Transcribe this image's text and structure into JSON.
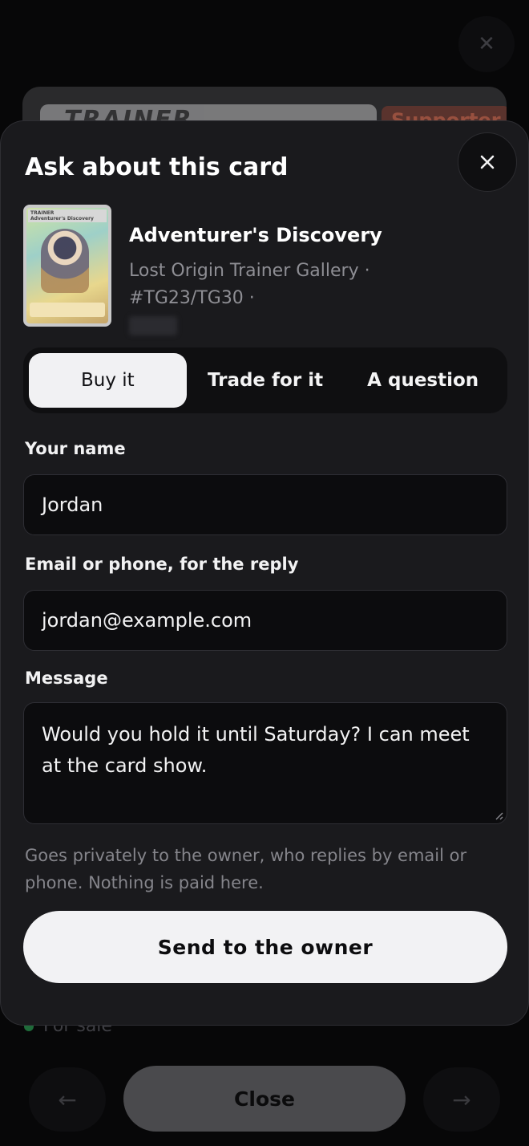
{
  "background": {
    "card_type": "TRAINER",
    "card_subtype": "Supporter",
    "status": "For sale",
    "close_label": "Close",
    "prev_arrow": "←",
    "next_arrow": "→",
    "icons": [
      "close-icon",
      "arrow-left-icon",
      "arrow-right-icon"
    ]
  },
  "sheet": {
    "title": "Ask about this card",
    "card": {
      "name": "Adventurer's Discovery",
      "meta": "Lost Origin Trainer Gallery · #TG23/TG30 ·",
      "thumb_type": "TRAINER",
      "thumb_name": "Adventurer's Discovery"
    },
    "tabs": [
      {
        "label": "Buy it",
        "active": true
      },
      {
        "label": "Trade for it",
        "active": false
      },
      {
        "label": "A question",
        "active": false
      }
    ],
    "fields": {
      "name_label": "Your name",
      "name_value": "Jordan",
      "contact_label": "Email or phone, for the reply",
      "contact_value": "jordan@example.com",
      "message_label": "Message",
      "message_value": "Would you hold it until Saturday? I can meet at the card show."
    },
    "hint": "Goes privately to the owner, who replies by email or phone. Nothing is paid here.",
    "send_label": "Send to the owner"
  },
  "colors": {
    "sheet_bg": "#1a1a1d",
    "accent_button": "#f2f2f4",
    "status_dot": "#1f6b3a"
  }
}
